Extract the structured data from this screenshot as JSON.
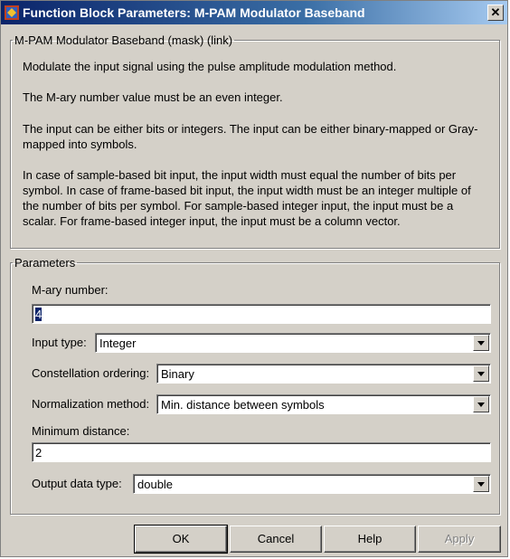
{
  "window": {
    "title": "Function Block Parameters: M-PAM Modulator Baseband",
    "close_glyph": "✕"
  },
  "description_group": {
    "legend": "M-PAM Modulator Baseband (mask) (link)",
    "paragraphs": [
      "Modulate the input signal using the pulse amplitude modulation method.",
      "The M-ary number value must be an even integer.",
      "The input can be either bits or integers.  The input can be either binary-mapped or Gray-mapped into symbols.",
      "In case of sample-based bit input, the input width must equal the number of bits per symbol. In case of frame-based bit input, the input width must be an integer multiple of the number of bits per symbol. For sample-based integer input, the input must be a scalar. For frame-based integer input, the input must be a column vector."
    ]
  },
  "parameters_group": {
    "legend": "Parameters",
    "mary_label": "M-ary number:",
    "mary_value": "4",
    "input_type_label": "Input type:",
    "input_type_value": "Integer",
    "constellation_label": "Constellation ordering:",
    "constellation_value": "Binary",
    "normalization_label": "Normalization method:",
    "normalization_value": "Min. distance between symbols",
    "min_distance_label": "Minimum distance:",
    "min_distance_value": "2",
    "output_type_label": "Output data type:",
    "output_type_value": "double"
  },
  "buttons": {
    "ok": "OK",
    "cancel": "Cancel",
    "help": "Help",
    "apply": "Apply"
  },
  "colors": {
    "titlebar_start": "#0a246a",
    "titlebar_end": "#a6caf0",
    "dialog_face": "#d4d0c8",
    "selection": "#0a246a"
  },
  "icons": {
    "app": "simulink-block-icon",
    "close": "close-icon",
    "dropdown": "chevron-down-icon"
  }
}
